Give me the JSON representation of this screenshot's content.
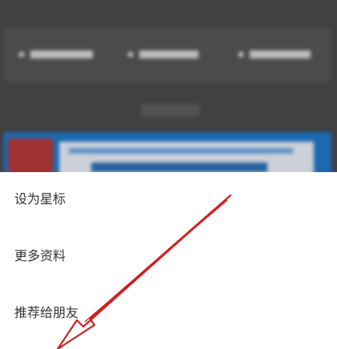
{
  "menu": {
    "items": [
      {
        "label": "设为星标"
      },
      {
        "label": "更多资料"
      },
      {
        "label": "推荐给朋友"
      }
    ]
  },
  "colors": {
    "backdrop": "#4a4a4a",
    "sheet": "#ffffff",
    "annotation_arrow": "#d11f1f"
  }
}
